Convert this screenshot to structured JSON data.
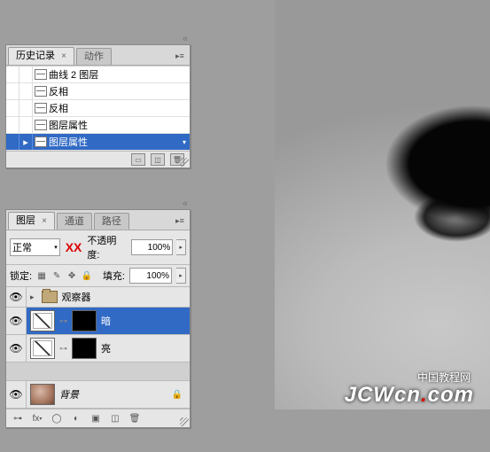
{
  "canvas": {
    "watermark_cn": "中国教程网",
    "watermark_main": "JCWcn",
    "watermark_dot": ".",
    "watermark_com": "com"
  },
  "history_panel": {
    "tabs": {
      "history": "历史记录",
      "actions": "动作"
    },
    "items": [
      {
        "label": "曲线 2 图层"
      },
      {
        "label": "反相"
      },
      {
        "label": "反相"
      },
      {
        "label": "图层属性"
      },
      {
        "label": "图层属性",
        "selected": true
      }
    ]
  },
  "layers_panel": {
    "tabs": {
      "layers": "图层",
      "channels": "通道",
      "paths": "路径"
    },
    "blend_mode": "正常",
    "xx_marker": "XX",
    "opacity_label": "不透明度:",
    "opacity_value": "100%",
    "lock_label": "锁定:",
    "fill_label": "填充:",
    "fill_value": "100%",
    "group_name": "观察器",
    "layers": [
      {
        "name": "暗",
        "type": "curves-mask",
        "selected": true
      },
      {
        "name": "亮",
        "type": "curves-mask"
      },
      {
        "name": "背景",
        "type": "image",
        "locked": true
      }
    ]
  }
}
